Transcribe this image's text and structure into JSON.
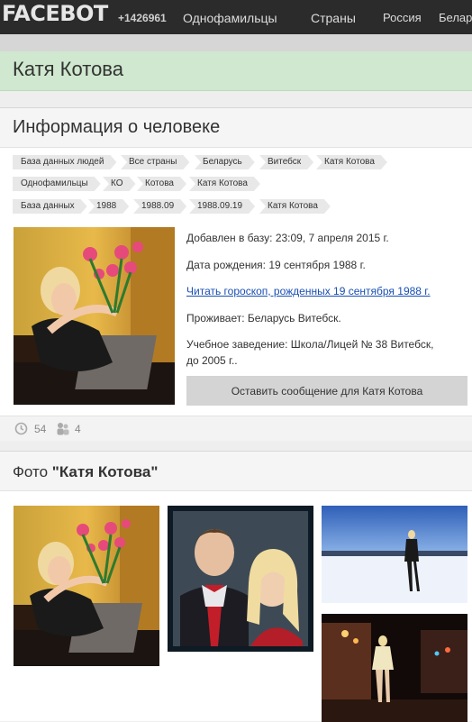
{
  "header": {
    "logo": "FACEBOT",
    "count": "+1426961",
    "nav": [
      "Однофамильцы",
      "Страны",
      "Россия",
      "Беларусь"
    ]
  },
  "person": {
    "name": "Катя Котова"
  },
  "info_card": {
    "title": "Информация о человеке",
    "breadcrumbs": [
      [
        "База данных людей",
        "Все страны",
        "Беларусь",
        "Витебск",
        "Катя Котова"
      ],
      [
        "Однофамильцы",
        "КО",
        "Котова",
        "Катя Котова"
      ],
      [
        "База данных",
        "1988",
        "1988.09",
        "1988.09.19",
        "Катя Котова"
      ]
    ],
    "added": "Добавлен в базу: 23:09, 7 апреля 2015 г.",
    "birth": "Дата рождения: 19 сентября 1988 г.",
    "horoscope_link": "Читать гороскоп, рожденных 19 сентября 1988 г.",
    "lives": "Проживает: Беларусь Витебск.",
    "school_line1": "Учебное заведение: Школа/Лицей № 38 Витебск,",
    "school_line2": "до 2005 г..",
    "message_button": "Оставить сообщение для Катя Котова",
    "views": "54",
    "friends": "4"
  },
  "photo_card": {
    "title_prefix": "Фото ",
    "title_name": "\"Катя Котова\""
  },
  "colors": {
    "namebar": "#cfe8cf",
    "topbar": "#2b2b2b",
    "link": "#1a4fb3"
  }
}
